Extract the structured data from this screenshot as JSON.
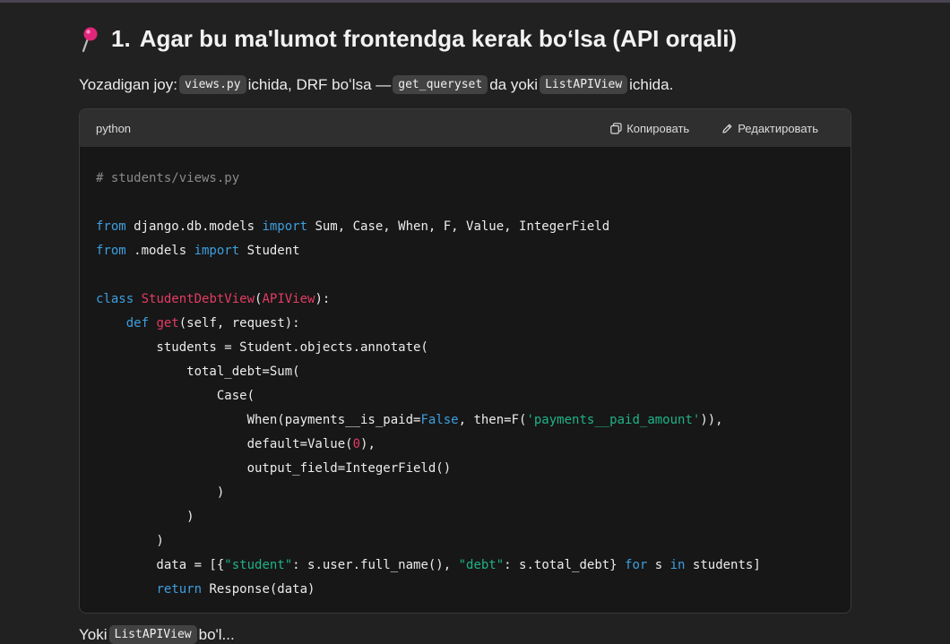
{
  "heading": {
    "number": "1.",
    "text": "Agar bu ma'lumot frontendga kerak boʻlsa (API orqali)",
    "icon": "pushpin-icon"
  },
  "intro": {
    "prefix": "Yozadigan joy: ",
    "code1": "views.py",
    "mid1": " ichida, DRF boʻlsa — ",
    "code2": "get_queryset",
    "mid2": "da yoki ",
    "code3": "ListAPIView",
    "suffix": " ichida."
  },
  "code_block": {
    "language": "python",
    "copy_label": "Копировать",
    "edit_label": "Редактировать",
    "lines": [
      [
        {
          "t": "# students/views.py",
          "c": "c"
        }
      ],
      [],
      [
        {
          "t": "from",
          "c": "k"
        },
        {
          "t": " django.db.models "
        },
        {
          "t": "import",
          "c": "k"
        },
        {
          "t": " Sum, Case, When, F, Value, IntegerField"
        }
      ],
      [
        {
          "t": "from",
          "c": "k"
        },
        {
          "t": " .models "
        },
        {
          "t": "import",
          "c": "k"
        },
        {
          "t": " Student"
        }
      ],
      [],
      [
        {
          "t": "class",
          "c": "k"
        },
        {
          "t": " "
        },
        {
          "t": "StudentDebtView",
          "c": "f"
        },
        {
          "t": "("
        },
        {
          "t": "APIView",
          "c": "f"
        },
        {
          "t": "):"
        }
      ],
      [
        {
          "t": "    "
        },
        {
          "t": "def",
          "c": "k"
        },
        {
          "t": " "
        },
        {
          "t": "get",
          "c": "f"
        },
        {
          "t": "(self, request):"
        }
      ],
      [
        {
          "t": "        students = Student.objects.annotate("
        }
      ],
      [
        {
          "t": "            total_debt=Sum("
        }
      ],
      [
        {
          "t": "                Case("
        }
      ],
      [
        {
          "t": "                    When(payments__is_paid="
        },
        {
          "t": "False",
          "c": "b"
        },
        {
          "t": ", then=F("
        },
        {
          "t": "'payments__paid_amount'",
          "c": "s"
        },
        {
          "t": ")),"
        }
      ],
      [
        {
          "t": "                    default=Value("
        },
        {
          "t": "0",
          "c": "n"
        },
        {
          "t": "),"
        }
      ],
      [
        {
          "t": "                    output_field=IntegerField()"
        }
      ],
      [
        {
          "t": "                )"
        }
      ],
      [
        {
          "t": "            )"
        }
      ],
      [
        {
          "t": "        )"
        }
      ],
      [
        {
          "t": "        data = [{"
        },
        {
          "t": "\"student\"",
          "c": "s"
        },
        {
          "t": ": s.user.full_name(), "
        },
        {
          "t": "\"debt\"",
          "c": "s"
        },
        {
          "t": ": s.total_debt} "
        },
        {
          "t": "for",
          "c": "k"
        },
        {
          "t": " s "
        },
        {
          "t": "in",
          "c": "k"
        },
        {
          "t": " students]"
        }
      ],
      [
        {
          "t": "        "
        },
        {
          "t": "return",
          "c": "k"
        },
        {
          "t": " Response(data)"
        }
      ]
    ]
  },
  "bottom": {
    "prefix": "Yoki ",
    "code": "ListAPIView",
    "suffix": " bo'l..."
  }
}
